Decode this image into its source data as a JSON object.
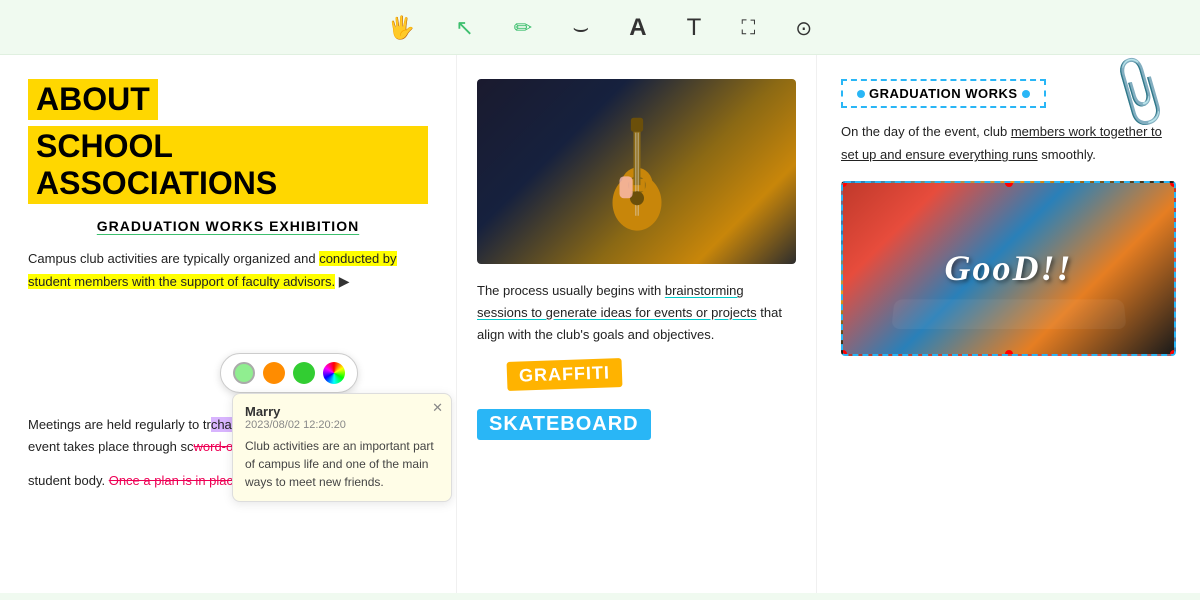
{
  "toolbar": {
    "tools": [
      {
        "name": "hand",
        "symbol": "☚",
        "label": "hand-tool"
      },
      {
        "name": "cursor",
        "symbol": "↖",
        "label": "cursor-tool",
        "active": true
      },
      {
        "name": "pen",
        "symbol": "✏",
        "label": "pen-tool"
      },
      {
        "name": "underline",
        "symbol": "⊔",
        "label": "underline-tool"
      },
      {
        "name": "font",
        "symbol": "A",
        "label": "font-tool"
      },
      {
        "name": "text",
        "symbol": "T",
        "label": "text-tool"
      },
      {
        "name": "crop",
        "symbol": "⌗",
        "label": "crop-tool"
      },
      {
        "name": "tag",
        "symbol": "◎",
        "label": "tag-tool"
      }
    ]
  },
  "left": {
    "title_line1": "ABOUT",
    "title_line2": "SCHOOL ASSOCIATIONS",
    "subtitle": "GRADUATION WORKS EXHIBITION",
    "para1_before": "Campus club activities are typically organized and ",
    "para1_highlight": "conducted by student members with the support of faculty advisors.",
    "para2_before": "Meetings are held regularly to tr",
    "para2_highlight_purple": "challenges, and make decisions",
    "para2_middle": " the event takes place through sc",
    "para2_strikethrough": "word-of-mouth to attract particip",
    "para2_end": "student body. ",
    "para2_strikethrough2": "Once a plan is in place, tasks are assigned"
  },
  "color_picker": {
    "colors": [
      "#90EE90",
      "#FF8C00",
      "#32CD32",
      "#FF1493"
    ]
  },
  "comment": {
    "author": "Marry",
    "date": "2023/08/02 12:20:20",
    "text": "Club activities are an important part of campus life and one of the main ways to meet new friends."
  },
  "middle": {
    "body_text_before": "The process usually begins with ",
    "body_underline": "brainstorming sessions to generate ideas for events or projects",
    "body_text_after": " that align with the club's goals and objectives.",
    "tag_graffiti": "GRAFFITI",
    "tag_skateboard": "SKATEBOARD"
  },
  "right": {
    "badge_text": "GRADUATION WORKS",
    "body_text_start": "On the day of the event, club ",
    "body_underline": "members work together to set up and ensure everything runs",
    "body_text_end": " smoothly.",
    "skate_overlay": "GooD!!"
  },
  "paperclip": {
    "symbol": "🖇"
  }
}
